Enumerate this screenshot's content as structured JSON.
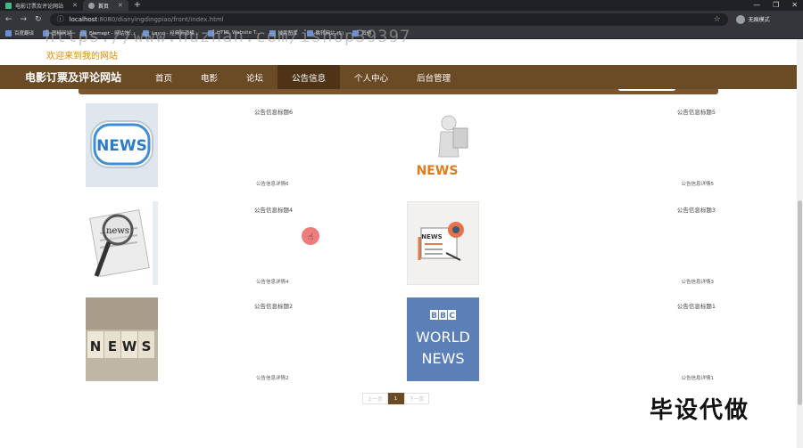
{
  "browser": {
    "tabs": [
      {
        "label": "电影订票及评论网站",
        "active": false
      },
      {
        "label": "首页",
        "active": true
      }
    ],
    "url_host": "localhost",
    "url_rest": ":8080/dianyingdingpiao/front/index.html",
    "profile_label": "无痕模式",
    "bookmarks": [
      "百度翻译",
      "图标网站",
      "Element - 网站快...",
      "Layui - 经典开源模...",
      "HTML Website T...",
      "搜索图库",
      "跳转网站 (5)",
      "其他"
    ]
  },
  "watermark": "https://www.huzhan.com/ishop39397",
  "welcome": "欢迎来到我的网站",
  "site": {
    "brand": "电影订票及评论网站",
    "nav": [
      "首页",
      "电影",
      "论坛",
      "公告信息",
      "个人中心",
      "后台管理"
    ],
    "active_nav": "公告信息"
  },
  "notices": [
    {
      "title": "公告信息标题6",
      "detail": "公告信息详情6",
      "image": "news-bubble"
    },
    {
      "title": "公告信息标题5",
      "detail": "公告信息详情5",
      "image": "news-figure"
    },
    {
      "title": "公告信息标题4",
      "detail": "公告信息详情4",
      "image": "news-magnifier"
    },
    {
      "title": "公告信息标题3",
      "detail": "公告信息详情3",
      "image": "news-flat"
    },
    {
      "title": "公告信息标题2",
      "detail": "公告信息详情2",
      "image": "news-blocks"
    },
    {
      "title": "公告信息标题1",
      "detail": "公告信息详情1",
      "image": "bbc-world-news"
    }
  ],
  "pager": {
    "prev": "上一页",
    "current": "1",
    "next": "下一页"
  },
  "overlay_text": "毕设代做",
  "colors": {
    "nav": "#6b4a26",
    "nav_active": "#4e3317",
    "welcome": "#e08a00"
  }
}
